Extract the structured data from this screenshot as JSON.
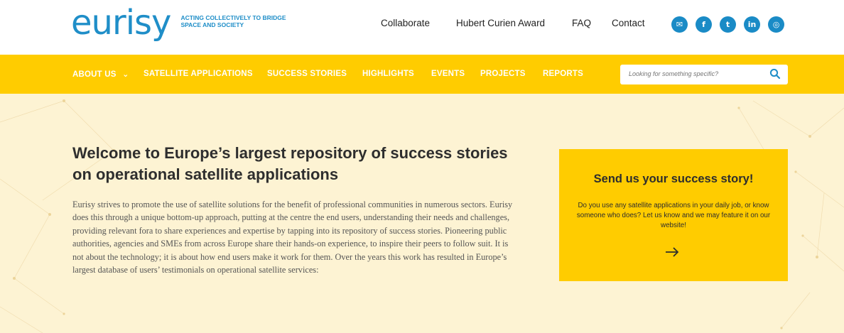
{
  "brand": {
    "logo_text": "eurisy",
    "tagline": "ACTING COLLECTIVELY TO BRIDGE SPACE AND SOCIETY",
    "color": "#1f8ec8"
  },
  "top_nav": {
    "items": [
      "Collaborate",
      "Hubert Curien Award",
      "FAQ",
      "Contact"
    ]
  },
  "social": {
    "icons": [
      "email-icon",
      "facebook-icon",
      "twitter-icon",
      "linkedin-icon",
      "instagram-icon"
    ],
    "glyphs": [
      "✉",
      "f",
      "t",
      "in",
      "◎"
    ]
  },
  "main_nav": {
    "background": "#ffcc00",
    "items": [
      "ABOUT US",
      "SATELLITE APPLICATIONS",
      "SUCCESS STORIES",
      "HIGHLIGHTS",
      "EVENTS",
      "PROJECTS",
      "REPORTS"
    ],
    "about_caret": "⌄"
  },
  "search": {
    "placeholder": "Looking for something specific?"
  },
  "hero": {
    "title": "Welcome to Europe’s largest repository of success stories on operational satellite applications",
    "body": "Eurisy strives to promote the use of satellite solutions for the benefit of professional communities in numerous sectors. Eurisy does this through a unique bottom-up approach, putting at the centre the end users, understanding their needs and challenges, providing relevant fora to share experiences and expertise by tapping into its repository of success stories. Pioneering public authorities, agencies and SMEs from across Europe share their hands-on experience, to inspire their peers to follow suit. It is not about the technology; it is about how end users make it work for them. Over the years this work has resulted in Europe’s largest database of users’ testimonials on operational satellite services:"
  },
  "cta_card": {
    "title": "Send us your success story!",
    "text": "Do you use any satellite applications in your daily job, or know someone who does? Let us know and we may feature it on our website!",
    "arrow": "→"
  }
}
